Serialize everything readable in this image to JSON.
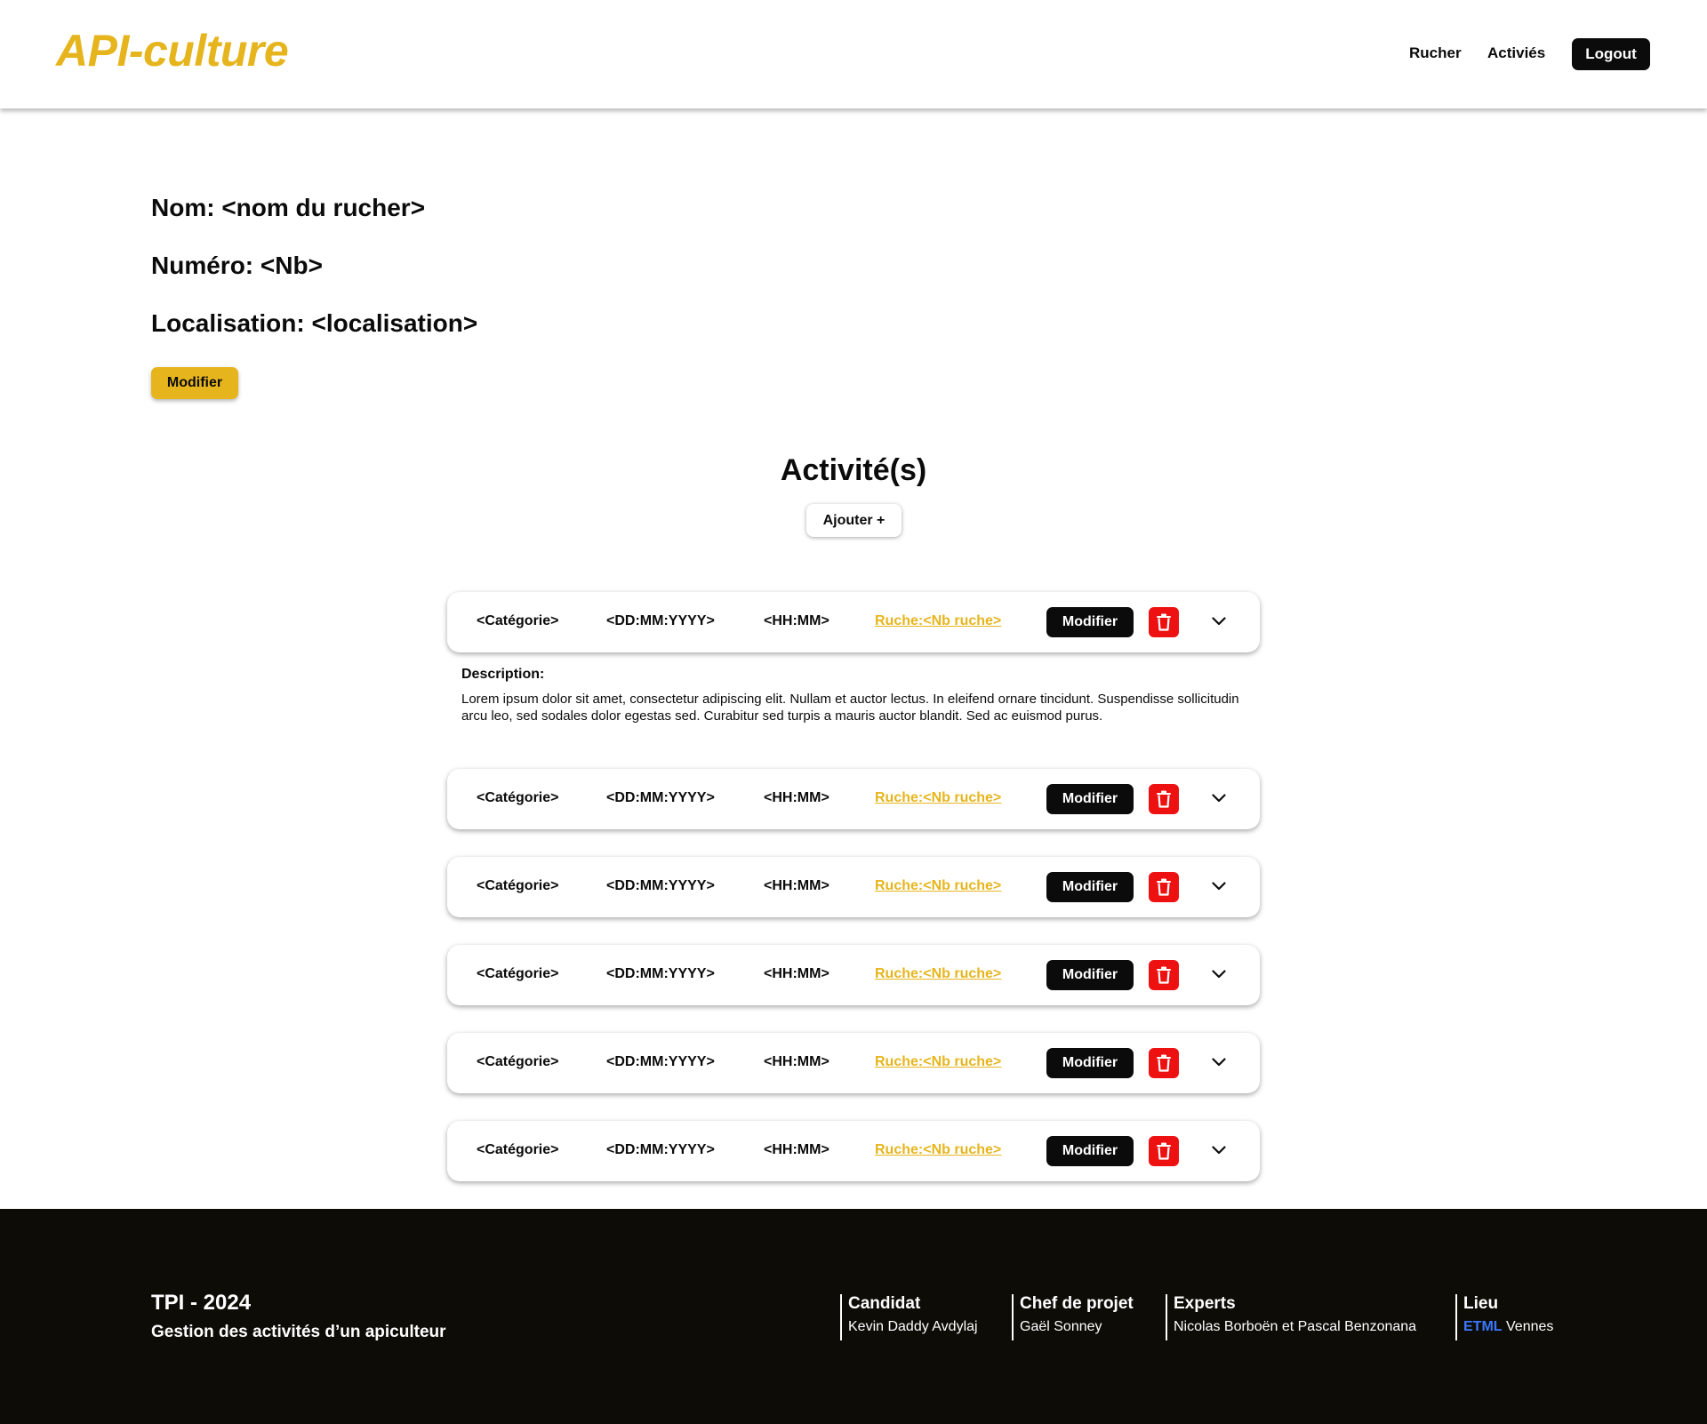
{
  "header": {
    "logo": "API-culture",
    "nav": {
      "rucher": "Rucher",
      "activites": "Activiés"
    },
    "logout": "Logout"
  },
  "info": {
    "nom": "Nom: <nom du rucher>",
    "numero": "Numéro: <Nb>",
    "localisation": "Localisation: <localisation>",
    "modify_label": "Modifier"
  },
  "activities_section": {
    "title": "Activité(s)",
    "add_label": "Ajouter +"
  },
  "activities": [
    {
      "category": "<Catégorie>",
      "date": "<DD:MM:YYYY>",
      "time": "<HH:MM>",
      "hive": "Ruche:<Nb ruche>",
      "modify_label": "Modifier",
      "expanded": true
    },
    {
      "category": "<Catégorie>",
      "date": "<DD:MM:YYYY>",
      "time": "<HH:MM>",
      "hive": "Ruche:<Nb ruche>",
      "modify_label": "Modifier",
      "expanded": false
    },
    {
      "category": "<Catégorie>",
      "date": "<DD:MM:YYYY>",
      "time": "<HH:MM>",
      "hive": "Ruche:<Nb ruche>",
      "modify_label": "Modifier",
      "expanded": false
    },
    {
      "category": "<Catégorie>",
      "date": "<DD:MM:YYYY>",
      "time": "<HH:MM>",
      "hive": "Ruche:<Nb ruche>",
      "modify_label": "Modifier",
      "expanded": false
    },
    {
      "category": "<Catégorie>",
      "date": "<DD:MM:YYYY>",
      "time": "<HH:MM>",
      "hive": "Ruche:<Nb ruche>",
      "modify_label": "Modifier",
      "expanded": false
    },
    {
      "category": "<Catégorie>",
      "date": "<DD:MM:YYYY>",
      "time": "<HH:MM>",
      "hive": "Ruche:<Nb ruche>",
      "modify_label": "Modifier",
      "expanded": false
    }
  ],
  "description": {
    "label": "Description:",
    "text": "Lorem ipsum dolor sit amet, consectetur adipiscing elit. Nullam et  auctor lectus. In eleifend ornare tincidunt. Suspendisse sollicitudin  arcu leo, sed sodales dolor egestas sed. Curabitur sed turpis a mauris  auctor blandit. Sed ac euismod purus."
  },
  "footer": {
    "title": "TPI - 2024",
    "subtitle": "Gestion des activités d’un apiculteur",
    "candidat": {
      "label": "Candidat",
      "value": "Kevin Daddy Avdylaj"
    },
    "chef": {
      "label": "Chef de projet",
      "value": "Gaël Sonney"
    },
    "experts": {
      "label": "Experts",
      "value": "Nicolas Borboën et Pascal Benzonana"
    },
    "lieu": {
      "label": "Lieu",
      "etml": "ETML",
      "city": "Vennes"
    }
  },
  "icons": {
    "delete": "trash-icon",
    "expand": "chevron-down-icon"
  },
  "colors": {
    "brand": "#e6b51e",
    "dark": "#0b0b0b",
    "danger": "#ee1111",
    "footer_bg": "#0e0c06",
    "etml": "#3b78ff"
  }
}
